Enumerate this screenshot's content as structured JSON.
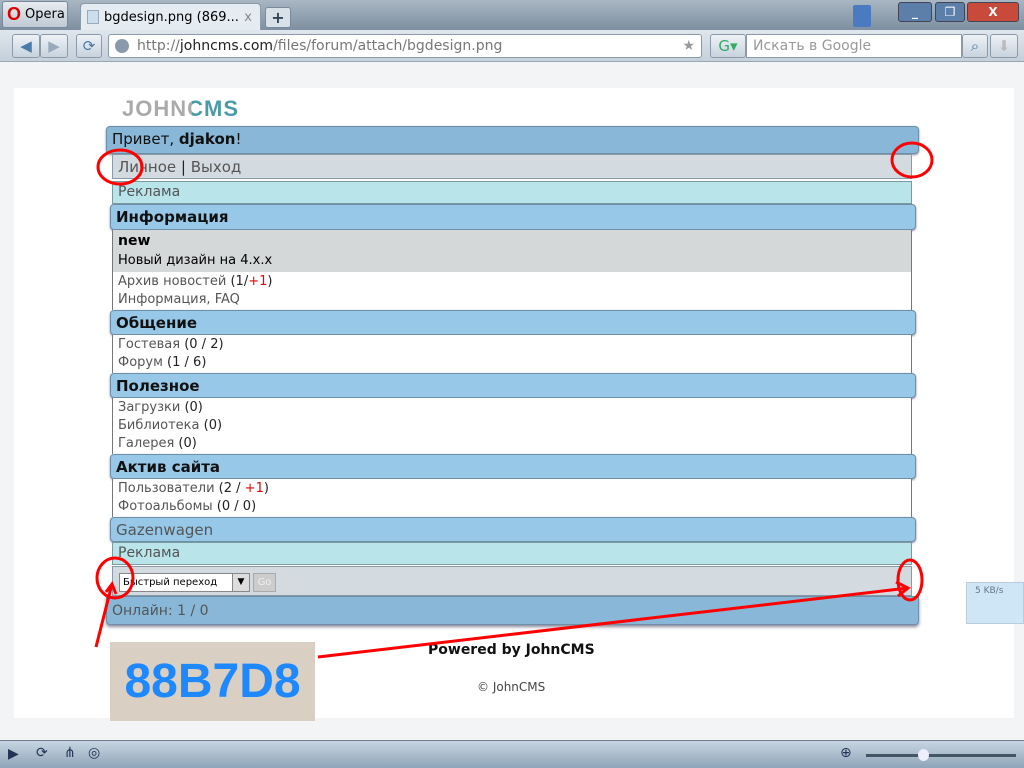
{
  "browser": {
    "app": "Opera",
    "tab_title": "bgdesign.png (869...",
    "tab_close": "x",
    "new_tab": "+",
    "url_prefix": "http://",
    "url_domain": "johncms.com",
    "url_path": "/files/forum/attach/bgdesign.png",
    "search_placeholder": "Искать в Google",
    "speed": "5 KB/s"
  },
  "site": {
    "logo": "JOHNCMS",
    "greeting": "Привет, ",
    "username": "djakon",
    "greeting_end": "!",
    "nav": {
      "personal": "Личное",
      "sep": " | ",
      "exit": "Выход"
    },
    "ad": "Реклама",
    "sections": [
      {
        "title": "Информация"
      },
      {
        "title": "Общение"
      },
      {
        "title": "Полезное"
      },
      {
        "title": "Актив сайта"
      }
    ],
    "news": {
      "title": "new",
      "text": "Новый дизайн на 4.х.х"
    },
    "info_items": {
      "archive": "Архив новостей",
      "archive_a": "1",
      "archive_b": "+1",
      "faq": "Информация, FAQ"
    },
    "comm_items": {
      "guest": "Гостевая",
      "guest_count": "0 / 2",
      "forum": "Форум",
      "forum_count": "1 / 6"
    },
    "useful_items": {
      "dl": "Загрузки",
      "dl_count": "0",
      "lib": "Библиотека",
      "lib_count": "0",
      "gal": "Галерея",
      "gal_count": "0"
    },
    "active_items": {
      "users": "Пользователи",
      "users_a": "2 / ",
      "users_b": "+1",
      "photos": "Фотоальбомы",
      "photos_count": "0 / 0"
    },
    "gazen": "Gazenwagen",
    "ad2": "Реклама",
    "quick_jump": "Быстрый переход",
    "go": "Go",
    "online": "Онлайн: 1 / 0",
    "powered": "Powered by JohnCMS",
    "copyright": "© JohnCMS"
  },
  "annotation": {
    "color_code": "88B7D8",
    "box_color": "#d9cfc3",
    "text_color": "#1e88ff"
  }
}
